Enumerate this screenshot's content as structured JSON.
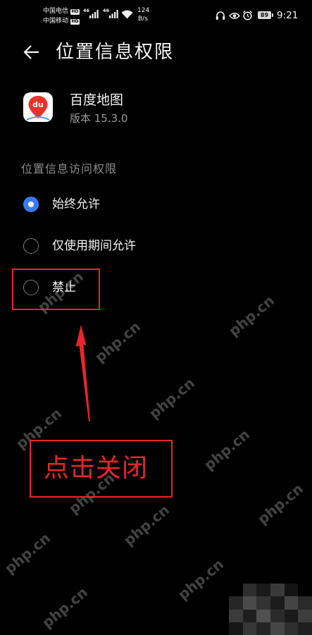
{
  "status_bar": {
    "carrier_1": "中国电信",
    "carrier_1_badge": "HD",
    "carrier_2": "中国移动",
    "carrier_2_badge": "HD",
    "signal_1_network": "46",
    "signal_2_network": "46",
    "net_speed_value": "124",
    "net_speed_unit": "B/s",
    "battery_level": "89",
    "time": "9:21",
    "icons": [
      "signal-bars-icon",
      "wifi-icon",
      "headphones-icon",
      "eye-icon",
      "alarm-icon",
      "battery-icon"
    ]
  },
  "header": {
    "back_icon": "back-arrow-icon",
    "title": "位置信息权限"
  },
  "app": {
    "icon": "baidu-map-app-icon",
    "logo_text": "du",
    "name": "百度地图",
    "version": "版本 15.3.0"
  },
  "permission_section": {
    "label": "位置信息访问权限",
    "options": [
      {
        "label": "始终允许",
        "selected": true
      },
      {
        "label": "仅使用期间允许",
        "selected": false
      },
      {
        "label": "禁止",
        "selected": false
      }
    ]
  },
  "annotation": {
    "callout_text": "点击关闭"
  },
  "watermark": {
    "text": "php.cn"
  },
  "colors": {
    "background": "#000000",
    "accent": "#3a7cf5",
    "annotation": "#e8262a"
  }
}
